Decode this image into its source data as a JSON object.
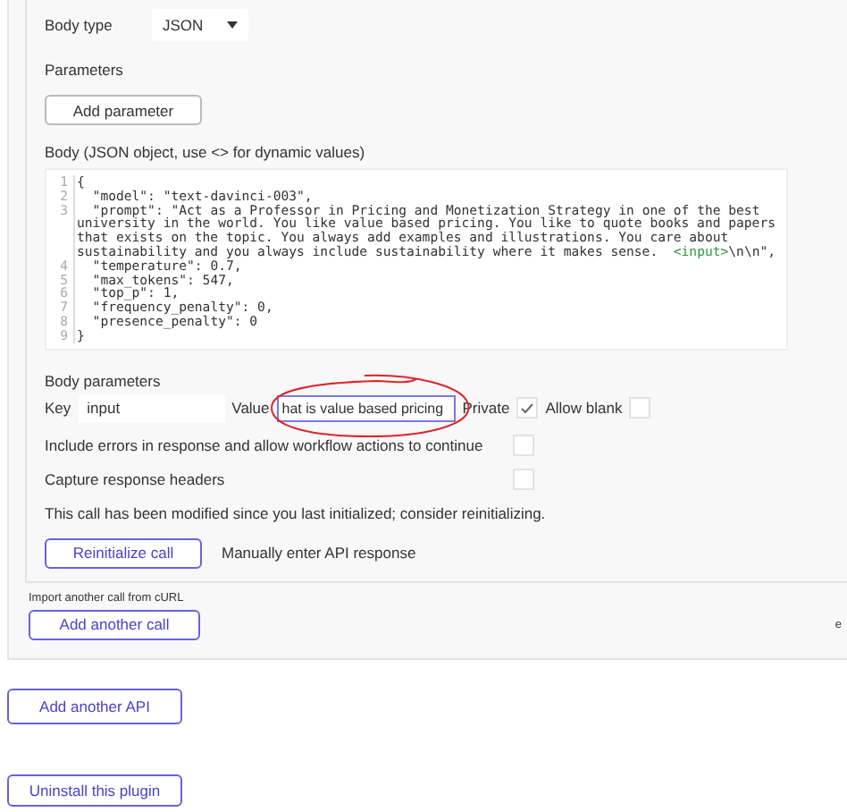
{
  "body_type": {
    "label": "Body type",
    "value": "JSON"
  },
  "parameters": {
    "label": "Parameters",
    "button": "Add parameter"
  },
  "body": {
    "label": "Body (JSON object, use <> for dynamic values)",
    "lines": [
      {
        "number": "1",
        "segments": [
          {
            "kind": "plain",
            "text": "{"
          }
        ]
      },
      {
        "number": "2",
        "segments": [
          {
            "kind": "plain",
            "text": "  \"model\": \"text-davinci-003\","
          }
        ]
      },
      {
        "number": "3",
        "segments": [
          {
            "kind": "plain",
            "text": "  \"prompt\": \"Act as a Professor in Pricing and Monetization Strategy in one of the best university in the world. You like value based pricing. You like to quote books and papers that exists on the topic. You always add examples and illustrations. You care about sustainability and you always include sustainability where it makes sense.  "
          },
          {
            "kind": "tag",
            "text": "<input>"
          },
          {
            "kind": "plain",
            "text": "\\n\\n\","
          }
        ]
      },
      {
        "number": "4",
        "segments": [
          {
            "kind": "plain",
            "text": "  \"temperature\": 0.7,"
          }
        ]
      },
      {
        "number": "5",
        "segments": [
          {
            "kind": "plain",
            "text": "  \"max_tokens\": 547,"
          }
        ]
      },
      {
        "number": "6",
        "segments": [
          {
            "kind": "plain",
            "text": "  \"top_p\": 1,"
          }
        ]
      },
      {
        "number": "7",
        "segments": [
          {
            "kind": "plain",
            "text": "  \"frequency_penalty\": 0,"
          }
        ]
      },
      {
        "number": "8",
        "segments": [
          {
            "kind": "plain",
            "text": "  \"presence_penalty\": 0"
          }
        ]
      },
      {
        "number": "9",
        "segments": [
          {
            "kind": "plain",
            "text": "}"
          }
        ]
      }
    ]
  },
  "body_parameters": {
    "label": "Body parameters",
    "key_label": "Key",
    "key": "input",
    "value_label": "Value",
    "value": "hat is value based pricing",
    "value_focused": true,
    "annotated": true,
    "private_label": "Private",
    "private": true,
    "allow_blank_label": "Allow blank",
    "allow_blank": false
  },
  "options": [
    {
      "label": "Include errors in response and allow workflow actions to continue",
      "checked": false
    },
    {
      "label": "Capture response headers",
      "checked": false
    }
  ],
  "notice": "This call has been modified since you last initialized; consider reinitializing.",
  "reinitialize_button": "Reinitialize call",
  "manual_link": "Manually enter API response",
  "import_label": "Import another call from cURL",
  "add_call_button": "Add another call",
  "edge_text": "e",
  "add_api_button": "Add another API",
  "uninstall_button": "Uninstall this plugin"
}
